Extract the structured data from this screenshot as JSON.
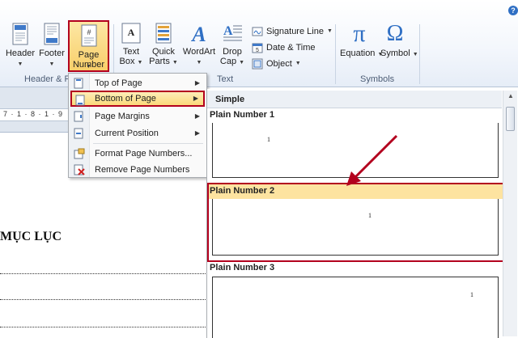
{
  "ribbon": {
    "header_label": "Header",
    "footer_label": "Footer",
    "page_number_label_1": "Page",
    "page_number_label_2": "Number",
    "page_number_icon_glyph": "#",
    "header_footer_group": "Header & F",
    "textbox_label_1": "Text",
    "textbox_label_2": "Box",
    "quickparts_label_1": "Quick",
    "quickparts_label_2": "Parts",
    "wordart_label": "WordArt",
    "dropcap_label_1": "Drop",
    "dropcap_label_2": "Cap",
    "signature_line": "Signature Line",
    "date_time": "Date & Time",
    "object": "Object",
    "text_group": "Text",
    "equation_label": "Equation",
    "equation_glyph": "π",
    "symbol_label": "Symbol",
    "symbol_glyph": "Ω",
    "symbols_group": "Symbols"
  },
  "menu": {
    "items": [
      {
        "label": "Top of Page",
        "has_submenu": true
      },
      {
        "label": "Bottom of Page",
        "has_submenu": true
      },
      {
        "label": "Page Margins",
        "has_submenu": true
      },
      {
        "label": "Current Position",
        "has_submenu": true
      },
      {
        "label": "Format Page Numbers...",
        "has_submenu": false
      },
      {
        "label": "Remove Page Numbers",
        "has_submenu": false
      }
    ]
  },
  "gallery": {
    "section": "Simple",
    "items": [
      {
        "title": "Plain Number 1",
        "number": "1"
      },
      {
        "title": "Plain Number 2",
        "number": "1"
      },
      {
        "title": "Plain Number 3",
        "number": "1"
      }
    ]
  },
  "document": {
    "ruler_text": "7 · 1 · 8 · 1 · 9",
    "heading": "MỤC LỤC"
  },
  "colors": {
    "highlight_border": "#b3001e",
    "selected_fill": "#fde3a0",
    "ribbon_bg": "#f4f7fc"
  }
}
